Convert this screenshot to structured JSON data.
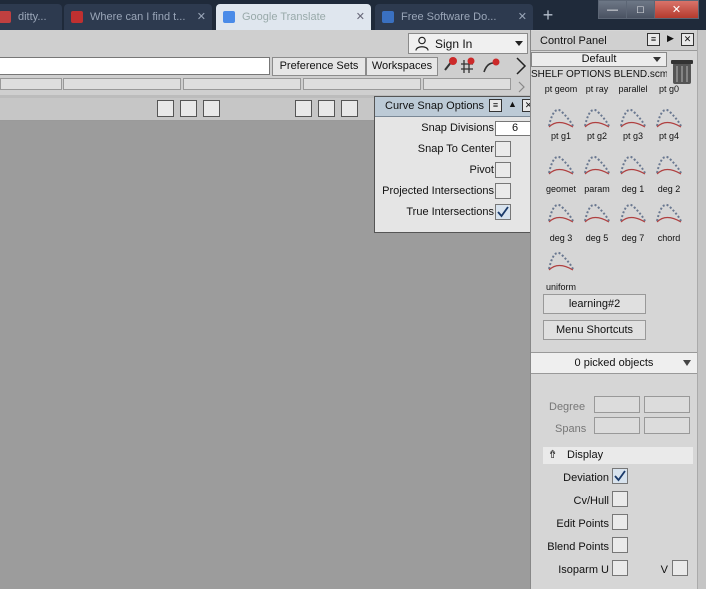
{
  "browser": {
    "tabs": [
      {
        "label": "ditty..."
      },
      {
        "label": "Where can I find t..."
      },
      {
        "label": "Google Translate"
      },
      {
        "label": "Free Software Do..."
      }
    ],
    "new_tab": "+",
    "controls": {
      "minimize": "—",
      "maximize": "□",
      "close": "✕"
    }
  },
  "toolbar": {
    "signin_label": "Sign In",
    "preference_sets": "Preference Sets",
    "workspaces": "Workspaces"
  },
  "snap_options": {
    "title": "Curve Snap Options",
    "rows": [
      {
        "label": "Snap Divisions",
        "value": "6"
      },
      {
        "label": "Snap To Center",
        "checked": false
      },
      {
        "label": "Pivot",
        "checked": false
      },
      {
        "label": "Projected Intersections",
        "checked": false
      },
      {
        "label": "True Intersections",
        "checked": true
      }
    ]
  },
  "control_panel": {
    "title": "Control Panel",
    "shelf_set": "Default",
    "shelf_name": "SHELF OPTIONS BLEND.scm",
    "shelf_items": [
      {
        "label": "pt geom",
        "icon": "pt-geom-icon"
      },
      {
        "label": "pt ray",
        "icon": "pt-ray-icon"
      },
      {
        "label": "parallel",
        "icon": "parallel-icon"
      },
      {
        "label": "pt g0",
        "icon": "pt-g0-icon"
      },
      {
        "label": "pt g1",
        "icon": "pt-g1-icon"
      },
      {
        "label": "pt g2",
        "icon": "pt-g2-icon"
      },
      {
        "label": "pt g3",
        "icon": "pt-g3-icon"
      },
      {
        "label": "pt g4",
        "icon": "pt-g4-icon"
      },
      {
        "label": "geomet",
        "icon": "geomet-icon"
      },
      {
        "label": "param",
        "icon": "param-icon"
      },
      {
        "label": "deg 1",
        "icon": "deg1-icon"
      },
      {
        "label": "deg 2",
        "icon": "deg2-icon"
      },
      {
        "label": "deg 3",
        "icon": "deg3-icon"
      },
      {
        "label": "deg 5",
        "icon": "deg5-icon"
      },
      {
        "label": "deg 7",
        "icon": "deg7-icon"
      },
      {
        "label": "chord",
        "icon": "chord-icon"
      },
      {
        "label": "uniform",
        "icon": "uniform-icon"
      }
    ],
    "shelf_tabs": [
      "learning#2",
      "Menu Shortcuts"
    ],
    "picked": "0 picked objects",
    "fields": {
      "degree": "Degree",
      "spans": "Spans"
    },
    "display": {
      "header": "Display",
      "rows": [
        {
          "label": "Deviation",
          "checked": true
        },
        {
          "label": "Cv/Hull",
          "checked": false
        },
        {
          "label": "Edit Points",
          "checked": false
        },
        {
          "label": "Blend Points",
          "checked": false
        },
        {
          "label": "Isoparm U",
          "checked": false
        }
      ],
      "v_label": "V"
    }
  }
}
